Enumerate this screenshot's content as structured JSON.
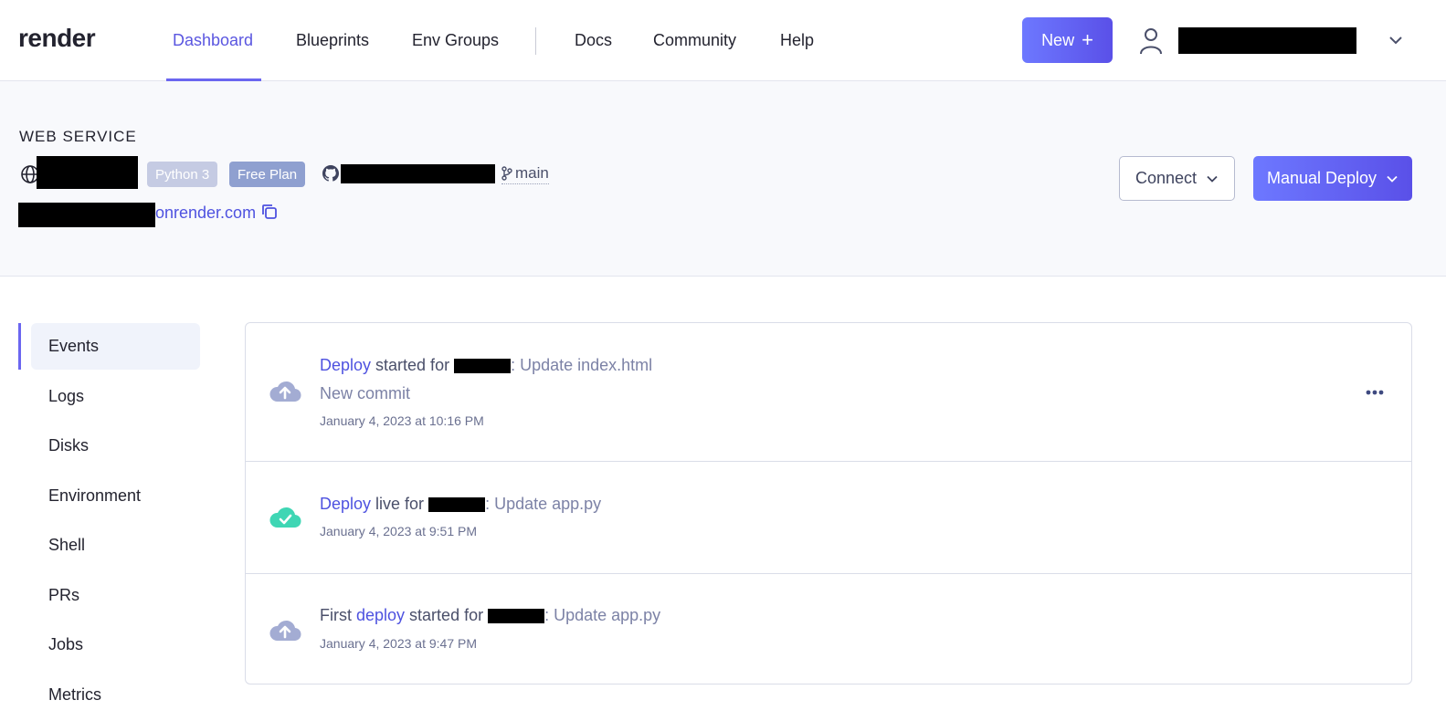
{
  "brand": {
    "logo_text": "render",
    "accent": "#6b66f0"
  },
  "nav": {
    "items": [
      "Dashboard",
      "Blueprints",
      "Env Groups",
      "Docs",
      "Community",
      "Help"
    ],
    "active": "Dashboard",
    "new_label": "New"
  },
  "service": {
    "type_label": "WEB SERVICE",
    "runtime_badge": "Python 3",
    "plan_badge": "Free Plan",
    "branch": "main",
    "url_suffix": "onrender.com",
    "connect_label": "Connect",
    "deploy_label": "Manual Deploy"
  },
  "sidebar": {
    "items": [
      "Events",
      "Logs",
      "Disks",
      "Environment",
      "Shell",
      "PRs",
      "Jobs",
      "Metrics"
    ],
    "active": "Events"
  },
  "events": [
    {
      "icon": "cloud-upload-icon",
      "prefix": "",
      "link": "Deploy",
      "action": " started for ",
      "message": ": Update index.html",
      "sub": "New commit",
      "time": "January 4, 2023 at 10:16 PM"
    },
    {
      "icon": "cloud-check-icon",
      "prefix": "",
      "link": "Deploy",
      "action": " live for ",
      "message": ": Update app.py",
      "sub": "",
      "time": "January 4, 2023 at 9:51 PM"
    },
    {
      "icon": "cloud-upload-icon",
      "prefix": "First ",
      "link": "deploy",
      "action": " started for ",
      "message": ": Update app.py",
      "sub": "",
      "time": "January 4, 2023 at 9:47 PM"
    }
  ]
}
